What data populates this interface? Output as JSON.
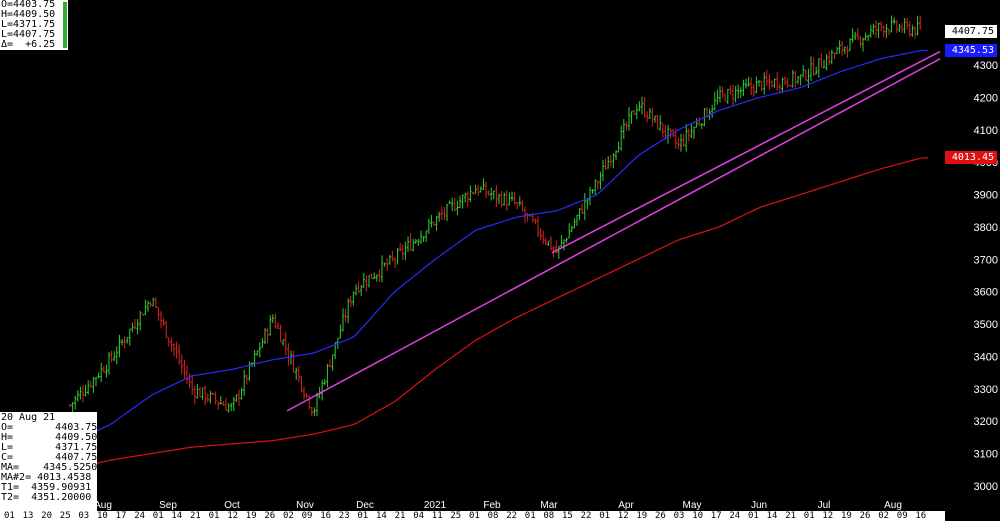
{
  "ohlc_header": {
    "open": "O=4403.75",
    "high": "H=4409.50",
    "low": "L=4371.75",
    "last": "L=4407.75",
    "delta": "Δ=  +6.25"
  },
  "info_box": {
    "date": "20 Aug 21",
    "o": "O=       4403.75",
    "h": "H=       4409.50",
    "l": "L=       4371.75",
    "c": "C=       4407.75",
    "ma": "MA=    4345.5250",
    "ma2": "MA#2= 4013.4538",
    "t1": "T1=  4359.90931",
    "t2": "T2=  4351.20000"
  },
  "price_tags": [
    {
      "label": "4407.75",
      "bg": "#ffffff",
      "fg": "#000000",
      "value": 4407.75
    },
    {
      "label": "4345.53",
      "bg": "#1a1aff",
      "fg": "#ffffff",
      "value": 4345.53
    },
    {
      "label": "4013.45",
      "bg": "#e01010",
      "fg": "#ffffff",
      "value": 4013.45
    }
  ],
  "colors": {
    "background": "#000000",
    "bar_up": "#33cc33",
    "bar_down": "#dd2222",
    "ma_fast": "#2a2aff",
    "ma_slow": "#dd1111",
    "trendline": "#e040e0",
    "axis_text": "#ffffff"
  },
  "x_axis_bottom": [
    "01",
    "13",
    "20",
    "25",
    "03",
    "10",
    "17",
    "24",
    "01",
    "14",
    "21",
    "01",
    "12",
    "19",
    "26",
    "02",
    "09",
    "16",
    "23",
    "01",
    "14",
    "21",
    "04",
    "11",
    "25",
    "01",
    "08",
    "22",
    "01",
    "08",
    "15",
    "22",
    "01",
    "12",
    "19",
    "26",
    "03",
    "10",
    "17",
    "24",
    "01",
    "14",
    "21",
    "01",
    "12",
    "19",
    "26",
    "02",
    "09",
    "16"
  ],
  "chart_data": {
    "type": "line",
    "instrument_period": "daily",
    "month_labels": [
      "Aug",
      "Sep",
      "Oct",
      "Nov",
      "Dec",
      "2021",
      "Feb",
      "Mar",
      "Apr",
      "May",
      "Jun",
      "Jul",
      "Aug"
    ],
    "yticks": [
      3000,
      3100,
      3200,
      3300,
      3400,
      3500,
      3600,
      3700,
      3800,
      3900,
      4000,
      4100,
      4200,
      4300
    ],
    "ylim": [
      2960,
      4480
    ],
    "series": [
      {
        "kind": "price",
        "month": [
          "Aug",
          "Sep",
          "Sep",
          "Sep",
          "Oct",
          "Oct",
          "Nov",
          "Nov",
          "Dec",
          "2021",
          "Feb",
          "Feb",
          "Mar",
          "Mar",
          "Apr",
          "May",
          "May",
          "Jun",
          "Jul",
          "Jul",
          "Aug",
          "Aug"
        ],
        "y": [
          3250,
          3390,
          3580,
          3300,
          3240,
          3520,
          3230,
          3610,
          3700,
          3820,
          3920,
          3870,
          3720,
          3940,
          4180,
          4050,
          4200,
          4240,
          4260,
          4350,
          4420,
          4407.75
        ]
      },
      {
        "kind": "ma_fast",
        "y": [
          3130,
          3190,
          3280,
          3340,
          3360,
          3390,
          3410,
          3460,
          3600,
          3700,
          3790,
          3830,
          3850,
          3900,
          4020,
          4100,
          4160,
          4200,
          4230,
          4280,
          4320,
          4345.53
        ]
      },
      {
        "kind": "ma_slow",
        "y": [
          3050,
          3080,
          3100,
          3120,
          3130,
          3140,
          3160,
          3190,
          3260,
          3360,
          3450,
          3520,
          3580,
          3640,
          3700,
          3760,
          3800,
          3860,
          3900,
          3940,
          3980,
          4013.45
        ]
      }
    ],
    "trendlines": [
      {
        "from": [
          3232,
          "Oct"
        ],
        "to": [
          4350,
          "Aug"
        ]
      },
      {
        "from": [
          3720,
          "Mar"
        ],
        "to": [
          4360,
          "Aug"
        ]
      }
    ],
    "grid": false,
    "legend": "none"
  }
}
